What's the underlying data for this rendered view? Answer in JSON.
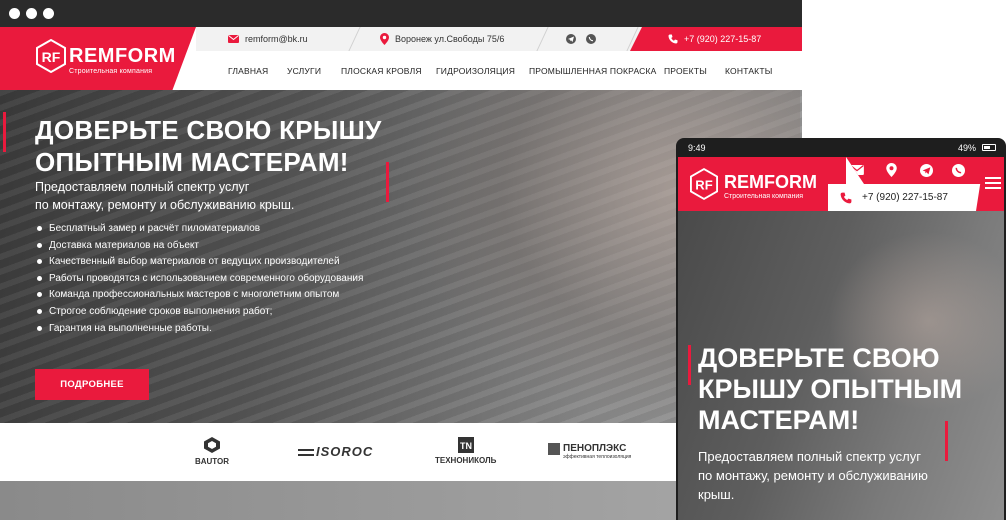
{
  "brand": {
    "name": "REMFORM",
    "tagline": "Строительная компания",
    "mark": "RF",
    "accent": "#ea1a3d"
  },
  "topbar": {
    "email": "remform@bk.ru",
    "address": "Воронеж ул.Свободы 75/6",
    "phone": "+7 (920) 227-15-87",
    "icons": [
      "mail-icon",
      "location-pin-icon",
      "telegram-icon",
      "whatsapp-icon",
      "phone-icon"
    ]
  },
  "nav": {
    "items": [
      "ГЛАВНАЯ",
      "УСЛУГИ",
      "ПЛОСКАЯ КРОВЛЯ",
      "ГИДРОИЗОЛЯЦИЯ",
      "ПРОМЫШЛЕННАЯ ПОКРАСКА",
      "ПРОЕКТЫ",
      "КОНТАКТЫ"
    ]
  },
  "hero": {
    "title_line1": "ДОВЕРЬТЕ СВОЮ КРЫШУ",
    "title_line2": "ОПЫТНЫМ МАСТЕРАМ!",
    "lead_line1": "Предоставляем полный спектр услуг",
    "lead_line2": "по монтажу, ремонту и обслуживанию крыш.",
    "bullets": [
      "Бесплатный замер и расчёт пиломатериалов",
      "Доставка материалов на объект",
      "Качественный выбор материалов от ведущих производителей",
      "Работы проводятся с использованием современного оборудования",
      "Команда профессиональных мастеров с многолетним опытом",
      "Строгое соблюдение сроков выполнения работ;",
      "Гарантия на выполненные работы."
    ],
    "button_label": "ПОДРОБНЕЕ"
  },
  "brands": {
    "items": [
      {
        "name": "BAUTOR",
        "icon": "bautor-logo-icon"
      },
      {
        "name": "ISOROC",
        "icon": "isoroc-logo-icon"
      },
      {
        "name": "ТЕХНОНИКОЛЬ",
        "icon": "tn-logo-icon"
      },
      {
        "name": "ПЕНОПЛЭКС",
        "sub": "эффективная теплоизоляция",
        "icon": "penoplex-logo-icon"
      }
    ]
  },
  "mobile": {
    "time": "9:49",
    "battery": "49%",
    "phone": "+7 (920) 227-15-87",
    "title_line1": "ДОВЕРЬТЕ СВОЮ",
    "title_line2": "КРЫШУ ОПЫТНЫМ",
    "title_line3": "МАСТЕРАМ!",
    "lead_line1": "Предоставляем полный спектр услуг",
    "lead_line2": "по монтажу, ремонту и обслуживанию",
    "lead_line3": "крыш."
  }
}
